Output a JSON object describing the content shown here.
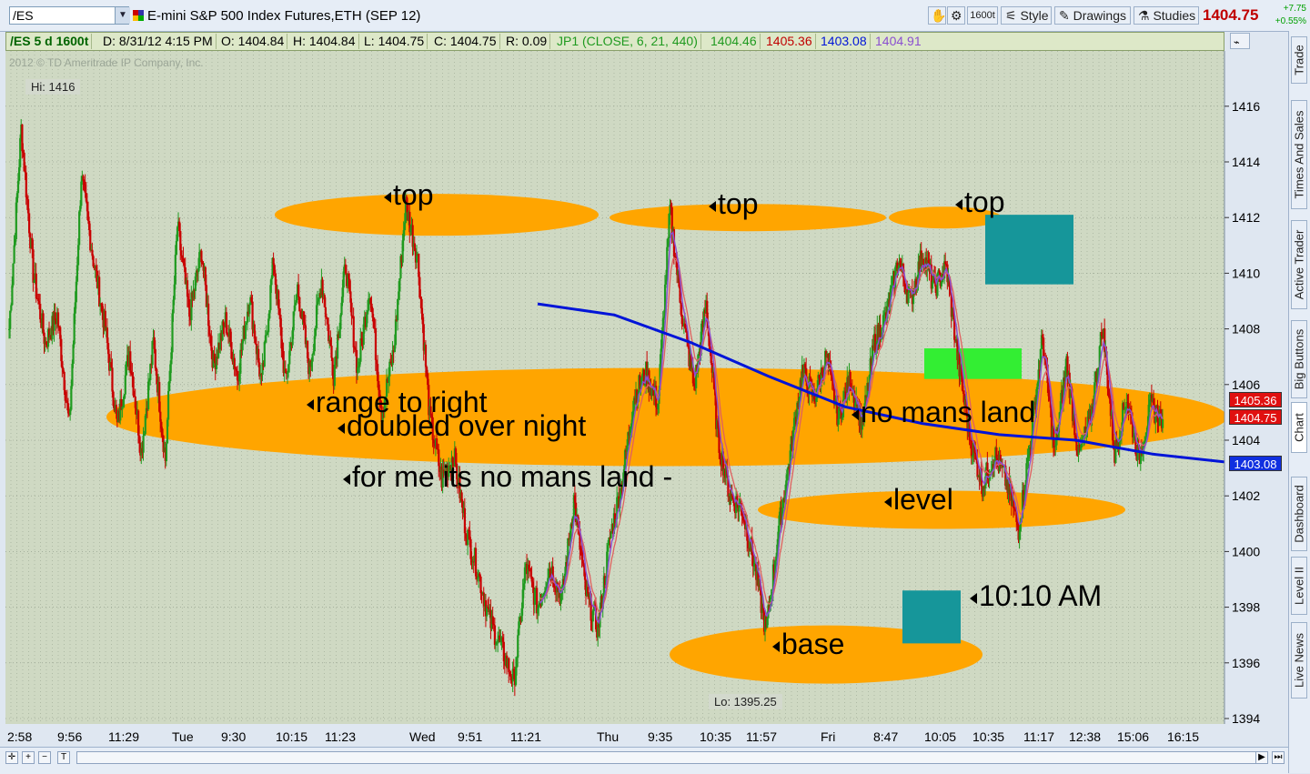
{
  "toolbar": {
    "symbol": "/ES",
    "title": "E-mini S&P 500 Index Futures,ETH (SEP 12)",
    "timeframe_badge": "1600t",
    "style_label": "Style",
    "drawings_label": "Drawings",
    "studies_label": "Studies",
    "last_price": "1404.75",
    "change_abs": "+7.75",
    "change_pct": "+0.55%"
  },
  "infobar": {
    "symbol_tf": "/ES 5 d 1600t",
    "date": "D: 8/31/12 4:15 PM",
    "open": "O: 1404.84",
    "high": "H: 1404.84",
    "low": "L: 1404.75",
    "close": "C: 1404.75",
    "range": "R: 0.09",
    "study": "JP1 (CLOSE, 6, 21, 440)",
    "study_v1": "1404.46",
    "study_v2": "1405.36",
    "study_v3": "1403.08",
    "study_v4": "1404.91"
  },
  "colors": {
    "up_bar": "#1f9a1f",
    "down_bar": "#c80000",
    "ma_blue": "#0014d8",
    "ma_red": "#e06060",
    "ma_purple": "#8a4fd0",
    "zone_orange": "#ffa500",
    "box_teal": "#16969a",
    "box_green": "#33ee33",
    "chart_bg": "#cfd9c3"
  },
  "chart_labels": {
    "copyright": "2012 © TD Ameritrade IP Company, Inc.",
    "hi": "Hi: 1416",
    "lo": "Lo: 1395.25"
  },
  "annotations": {
    "top1": "top",
    "top2": "top",
    "top3": "top",
    "range": "range to right",
    "doubled": "doubled over night",
    "nomans_me": "for me its no mans land -",
    "nomans": "no mans land",
    "level": "level",
    "base": "base",
    "time": "10:10 AM"
  },
  "price_tags": {
    "ma_red": "1405.36",
    "last": "1404.75",
    "ma_blue": "1403.08"
  },
  "sidetabs": [
    "Trade",
    "Times And Sales",
    "Active Trader",
    "Big Buttons",
    "Chart",
    "Dashboard",
    "Level II",
    "Live News"
  ],
  "chart_data": {
    "type": "candlestick",
    "symbol": "/ES",
    "aggregation": "1600 tick",
    "ylim": [
      1394,
      1417
    ],
    "y_ticks": [
      1394,
      1396,
      1398,
      1400,
      1402,
      1404,
      1406,
      1408,
      1410,
      1412,
      1414,
      1416
    ],
    "x_ticks": [
      "2:58",
      "9:56",
      "11:29",
      "Tue",
      "9:30",
      "10:15",
      "11:23",
      "Wed",
      "9:51",
      "11:21",
      "Thu",
      "9:35",
      "10:35",
      "11:57",
      "Fri",
      "8:47",
      "10:05",
      "10:35",
      "11:17",
      "12:38",
      "15:06",
      "16:15"
    ],
    "price_path": [
      1408,
      1415.2,
      1410,
      1407.5,
      1408.5,
      1404.5,
      1413.5,
      1410.5,
      1408,
      1404.5,
      1407.2,
      1403.6,
      1407.5,
      1403.3,
      1411.7,
      1408.5,
      1410.8,
      1406.7,
      1408.3,
      1406.3,
      1409.2,
      1406,
      1410.5,
      1406,
      1409.5,
      1406.5,
      1409.8,
      1406.4,
      1410.3,
      1406.5,
      1409.5,
      1405,
      1407.2,
      1412.5,
      1410.5,
      1404.8,
      1402.6,
      1403.5,
      1400.8,
      1399.3,
      1397.5,
      1396.5,
      1395.3,
      1399.5,
      1398,
      1399.5,
      1398.3,
      1401.9,
      1398.5,
      1397.2,
      1400.5,
      1402.5,
      1405.6,
      1406.4,
      1405.3,
      1412.3,
      1408.5,
      1405.9,
      1408.9,
      1404,
      1402,
      1401.5,
      1399.6,
      1397.1,
      1400.7,
      1403.5,
      1406.5,
      1405.5,
      1407,
      1404.8,
      1406.2,
      1404.5,
      1407.5,
      1408.5,
      1410.5,
      1409,
      1410.7,
      1409.5,
      1410.2,
      1406.8,
      1404,
      1402.4,
      1403.5,
      1402.5,
      1400.8,
      1404,
      1407.7,
      1403.5,
      1406.8,
      1403.4,
      1404.8,
      1408.1,
      1403.5,
      1405.6,
      1403.3,
      1405.2,
      1404.75
    ],
    "ma_blue_440": [
      [
        10,
        1408.9
      ],
      [
        12,
        1408.5
      ],
      [
        14,
        1407.5
      ],
      [
        16,
        1406.3
      ],
      [
        18,
        1405.2
      ],
      [
        20,
        1404.6
      ],
      [
        22,
        1404.2
      ],
      [
        24,
        1404.0
      ],
      [
        26,
        1403.5
      ],
      [
        28,
        1403.2
      ],
      [
        30,
        1403.08
      ]
    ],
    "zones": [
      {
        "label": "top",
        "y": 1412.1
      },
      {
        "label": "top",
        "y": 1412
      },
      {
        "label": "top",
        "y": 1412
      },
      {
        "label": "range to right",
        "y": 1404.9
      },
      {
        "label": "level",
        "y": 1401.5
      },
      {
        "label": "base",
        "y": 1396.3
      }
    ],
    "boxes": [
      {
        "y_top": 1412.1,
        "y_bottom": 1409.6,
        "color": "teal"
      },
      {
        "y_top": 1407.3,
        "y_bottom": 1406.2,
        "color": "green"
      },
      {
        "y_top": 1398.6,
        "y_bottom": 1396.7,
        "color": "teal"
      }
    ]
  }
}
